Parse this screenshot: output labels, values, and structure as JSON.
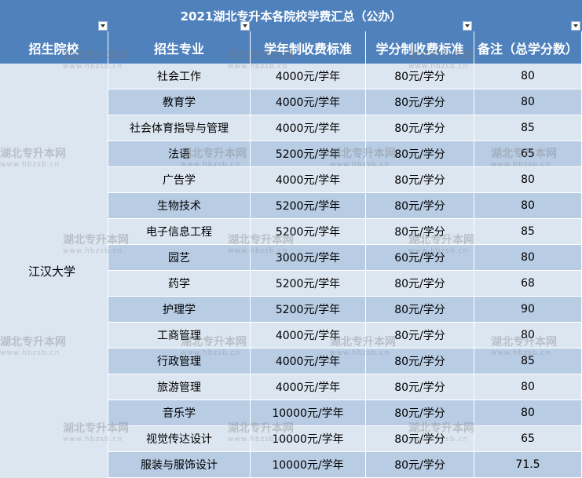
{
  "title": "2021湖北专升本各院校学费汇总（公办）",
  "headers": [
    "招生院校",
    "招生专业",
    "学年制收费标准",
    "学分制收费标准",
    "备注（总学分数）"
  ],
  "school": "江汉大学",
  "rows": [
    {
      "major": "社会工作",
      "yearly": "4000元/学年",
      "credit": "80元/学分",
      "note": "80"
    },
    {
      "major": "教育学",
      "yearly": "4000元/学年",
      "credit": "80元/学分",
      "note": "80"
    },
    {
      "major": "社会体育指导与管理",
      "yearly": "4000元/学年",
      "credit": "80元/学分",
      "note": "85"
    },
    {
      "major": "法语",
      "yearly": "5200元/学年",
      "credit": "80元/学分",
      "note": "65"
    },
    {
      "major": "广告学",
      "yearly": "4000元/学年",
      "credit": "80元/学分",
      "note": "80"
    },
    {
      "major": "生物技术",
      "yearly": "5200元/学年",
      "credit": "80元/学分",
      "note": "80"
    },
    {
      "major": "电子信息工程",
      "yearly": "5200元/学年",
      "credit": "80元/学分",
      "note": "85"
    },
    {
      "major": "园艺",
      "yearly": "3000元/学年",
      "credit": "60元/学分",
      "note": "80"
    },
    {
      "major": "药学",
      "yearly": "5200元/学年",
      "credit": "80元/学分",
      "note": "68"
    },
    {
      "major": "护理学",
      "yearly": "5200元/学年",
      "credit": "80元/学分",
      "note": "90"
    },
    {
      "major": "工商管理",
      "yearly": "4000元/学年",
      "credit": "80元/学分",
      "note": "80"
    },
    {
      "major": "行政管理",
      "yearly": "4000元/学年",
      "credit": "80元/学分",
      "note": "85"
    },
    {
      "major": "旅游管理",
      "yearly": "4000元/学年",
      "credit": "80元/学分",
      "note": "80"
    },
    {
      "major": "音乐学",
      "yearly": "10000元/学年",
      "credit": "80元/学分",
      "note": "80"
    },
    {
      "major": "视觉传达设计",
      "yearly": "10000元/学年",
      "credit": "80元/学分",
      "note": "65"
    },
    {
      "major": "服装与服饰设计",
      "yearly": "10000元/学年",
      "credit": "80元/学分",
      "note": "71.5"
    }
  ],
  "watermark": {
    "text": "湖北专升本网",
    "url": "www.hbzsb.cn"
  }
}
